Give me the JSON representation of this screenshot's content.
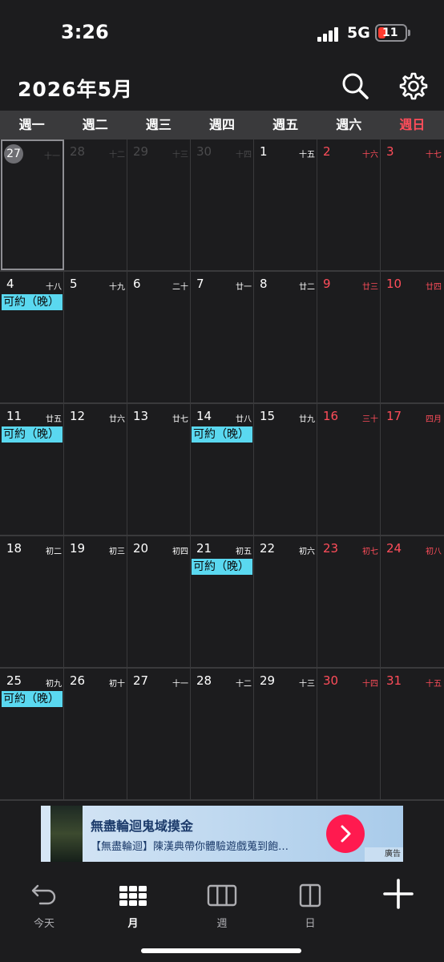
{
  "status_bar": {
    "time": "3:26",
    "network": "5G",
    "battery": "11",
    "battery_level": 0.11
  },
  "header": {
    "title": "2026年5月"
  },
  "weekdays": [
    "週一",
    "週二",
    "週三",
    "週四",
    "週五",
    "週六",
    "週日"
  ],
  "weeks": [
    {
      "days": [
        {
          "day": "27",
          "lunar": "十一",
          "dim": true,
          "today": true
        },
        {
          "day": "28",
          "lunar": "十二",
          "dim": true
        },
        {
          "day": "29",
          "lunar": "十三",
          "dim": true
        },
        {
          "day": "30",
          "lunar": "十四",
          "dim": true
        },
        {
          "day": "1",
          "lunar": "十五"
        },
        {
          "day": "2",
          "lunar": "十六"
        },
        {
          "day": "3",
          "lunar": "十七"
        }
      ]
    },
    {
      "days": [
        {
          "day": "4",
          "lunar": "十八",
          "event": "可約（晚）"
        },
        {
          "day": "5",
          "lunar": "十九"
        },
        {
          "day": "6",
          "lunar": "二十"
        },
        {
          "day": "7",
          "lunar": "廿一"
        },
        {
          "day": "8",
          "lunar": "廿二"
        },
        {
          "day": "9",
          "lunar": "廿三"
        },
        {
          "day": "10",
          "lunar": "廿四"
        }
      ]
    },
    {
      "days": [
        {
          "day": "11",
          "lunar": "廿五",
          "event": "可約（晚）"
        },
        {
          "day": "12",
          "lunar": "廿六"
        },
        {
          "day": "13",
          "lunar": "廿七"
        },
        {
          "day": "14",
          "lunar": "廿八",
          "event": "可約（晚）"
        },
        {
          "day": "15",
          "lunar": "廿九"
        },
        {
          "day": "16",
          "lunar": "三十"
        },
        {
          "day": "17",
          "lunar": "四月"
        }
      ]
    },
    {
      "days": [
        {
          "day": "18",
          "lunar": "初二"
        },
        {
          "day": "19",
          "lunar": "初三"
        },
        {
          "day": "20",
          "lunar": "初四"
        },
        {
          "day": "21",
          "lunar": "初五",
          "event": "可約（晚）"
        },
        {
          "day": "22",
          "lunar": "初六"
        },
        {
          "day": "23",
          "lunar": "初七"
        },
        {
          "day": "24",
          "lunar": "初八"
        }
      ]
    },
    {
      "days": [
        {
          "day": "25",
          "lunar": "初九",
          "event": "可約（晚）"
        },
        {
          "day": "26",
          "lunar": "初十"
        },
        {
          "day": "27",
          "lunar": "十一"
        },
        {
          "day": "28",
          "lunar": "十二"
        },
        {
          "day": "29",
          "lunar": "十三"
        },
        {
          "day": "30",
          "lunar": "十四"
        },
        {
          "day": "31",
          "lunar": "十五"
        }
      ]
    }
  ],
  "ad": {
    "title": "無盡輪迴鬼域摸金",
    "subtitle": "【無盡輪迴】陳漢典帶你體驗遊戲蒐到飽…",
    "tag": "廣告"
  },
  "tabbar": {
    "items": [
      {
        "label": "今天",
        "icon": "undo-arrow-icon"
      },
      {
        "label": "月",
        "icon": "month-grid-icon",
        "active": true
      },
      {
        "label": "週",
        "icon": "week-columns-icon"
      },
      {
        "label": "日",
        "icon": "day-columns-icon"
      },
      {
        "label": "",
        "icon": "plus-icon"
      }
    ]
  },
  "colors": {
    "background": "#1c1c1e",
    "weekend": "#ff4d5a",
    "event": "#5ad8f0",
    "weekbar": "#3a3a3c"
  }
}
